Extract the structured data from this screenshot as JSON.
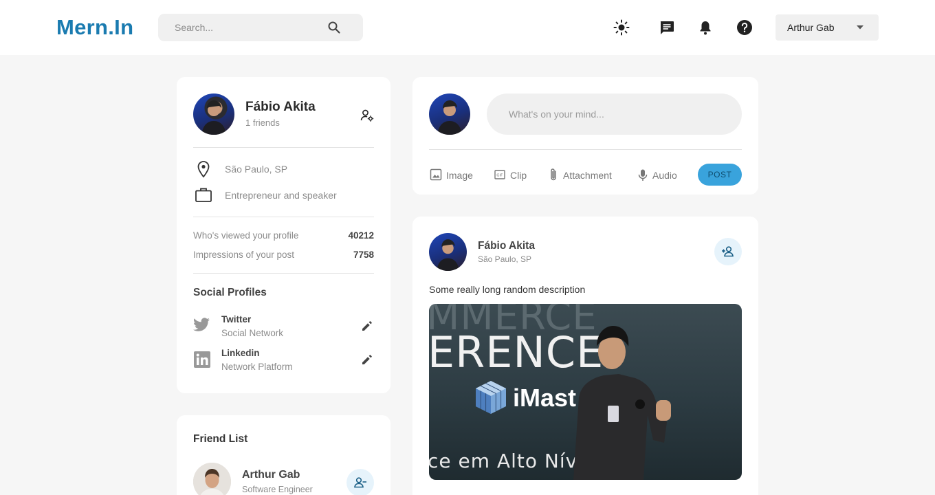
{
  "brand": {
    "logo": "Mern.In",
    "accent": "#1a7bb0",
    "button": "#39a3dc"
  },
  "search": {
    "placeholder": "Search...",
    "icon": "search-icon"
  },
  "navbar": {
    "icons": [
      "light-mode-icon",
      "message-icon",
      "notification-icon",
      "help-icon"
    ],
    "user_select": {
      "value": "Arthur Gab"
    }
  },
  "profile": {
    "name": "Fábio Akita",
    "friends": "1 friends",
    "location": "São Paulo, SP",
    "occupation": "Entrepreneur and speaker",
    "stats": [
      {
        "label": "Who's viewed your profile",
        "value": "40212"
      },
      {
        "label": "Impressions of your post",
        "value": "7758"
      }
    ],
    "social_title": "Social Profiles",
    "socials": [
      {
        "name": "Twitter",
        "sub": "Social Network",
        "icon": "twitter-icon"
      },
      {
        "name": "Linkedin",
        "sub": "Network Platform",
        "icon": "linkedin-icon"
      }
    ]
  },
  "friend_list": {
    "title": "Friend List",
    "friends": [
      {
        "name": "Arthur Gab",
        "sub": "Software Engineer"
      }
    ]
  },
  "composer": {
    "placeholder": "What's on your mind...",
    "actions": [
      "Image",
      "Clip",
      "Attachment",
      "Audio"
    ],
    "post_label": "POST"
  },
  "post": {
    "author": "Fábio Akita",
    "location": "São Paulo, SP",
    "description": "Some really long random description",
    "image_text": {
      "line1": "MMERCE",
      "line2": "ERENCE",
      "brand": "iMast",
      "bottom": "ce em Alto Níve"
    }
  }
}
